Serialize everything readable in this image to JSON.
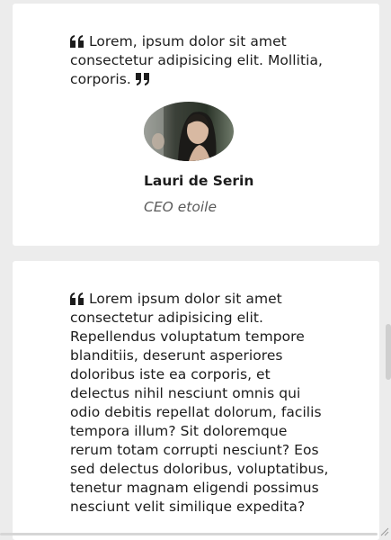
{
  "testimonials": [
    {
      "quote": "Lorem, ipsum dolor sit amet consectetur adipisicing elit. Mollitia, corporis.",
      "name": "Lauri de Serin",
      "role": "CEO etoile"
    },
    {
      "quote": "Lorem ipsum dolor sit amet consectetur adipisicing elit. Repellendus voluptatum tempore blanditiis, deserunt asperiores doloribus iste ea corporis, et delectus nihil nesciunt omnis qui odio debitis repellat dolorum, facilis tempora illum? Sit doloremque rerum totam corrupti nesciunt? Eos sed delectus doloribus, voluptatibus, tenetur magnam eligendi possimus nesciunt velit similique expedita?"
    }
  ],
  "icons": {
    "open_quote": "quote-left-icon",
    "close_quote": "quote-right-icon"
  },
  "colors": {
    "background": "#ececec",
    "card": "#ffffff",
    "text": "#1c1c1c",
    "role_text": "#5a5a5a"
  }
}
